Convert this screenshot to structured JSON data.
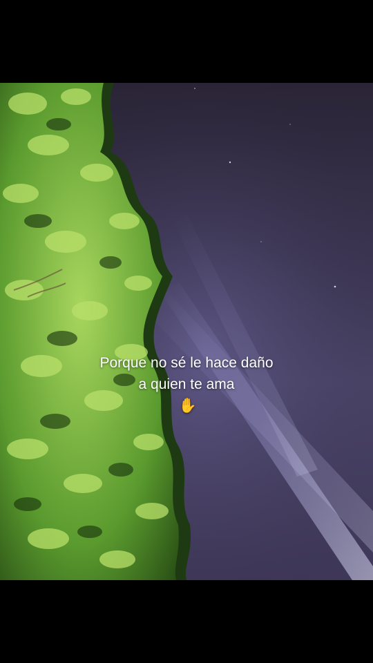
{
  "caption": {
    "line1": "Porque no sé le hace daño",
    "line2": "a quien te ama",
    "emoji": "✋"
  },
  "colors": {
    "sky_top": "#2a2436",
    "sky_mid": "#4a4468",
    "beam": "#c8c8ff",
    "foliage_dark": "#1e3a12",
    "foliage_mid": "#4f8a2a",
    "foliage_light": "#9fd25a"
  }
}
